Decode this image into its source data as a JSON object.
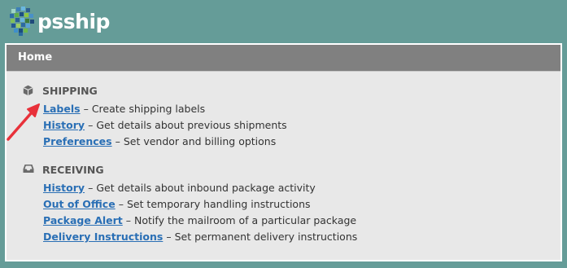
{
  "brand": {
    "name": "psship"
  },
  "panel": {
    "title": "Home"
  },
  "shipping": {
    "title": "SHIPPING",
    "icon": "box-icon",
    "items": [
      {
        "label": "Labels",
        "desc": "Create shipping labels"
      },
      {
        "label": "History",
        "desc": "Get details about previous shipments"
      },
      {
        "label": "Preferences",
        "desc": "Set vendor and billing options"
      }
    ]
  },
  "receiving": {
    "title": "RECEIVING",
    "icon": "inbox-tray-icon",
    "items": [
      {
        "label": "History",
        "desc": "Get details about inbound package activity"
      },
      {
        "label": "Out of Office",
        "desc": "Set temporary handling instructions"
      },
      {
        "label": "Package Alert",
        "desc": "Notify the mailroom of a particular package"
      },
      {
        "label": "Delivery Instructions",
        "desc": "Set permanent delivery instructions"
      }
    ]
  },
  "separator": "–",
  "colors": {
    "background": "#659c98",
    "header": "#808080",
    "link": "#2a6fb5",
    "arrow": "#e8313a"
  }
}
